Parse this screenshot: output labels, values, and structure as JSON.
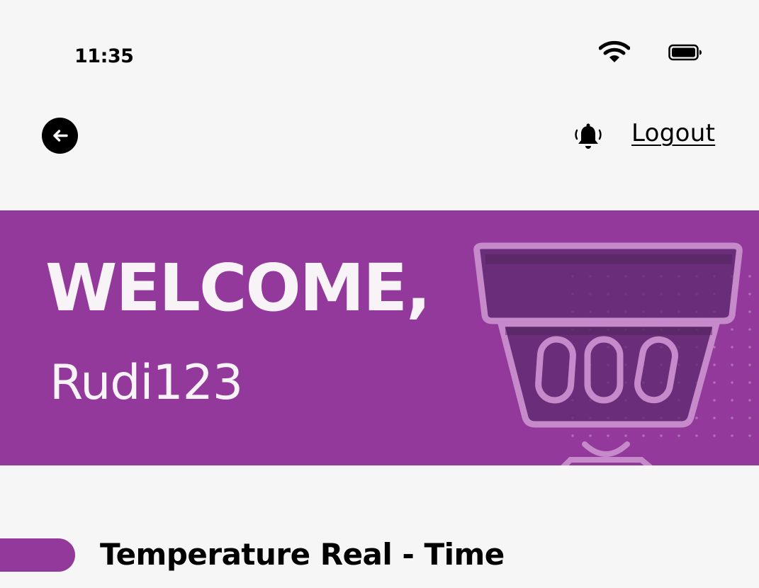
{
  "status_bar": {
    "time": "11:35",
    "wifi_icon": "wifi-icon",
    "battery_icon": "battery-icon"
  },
  "header": {
    "back_icon": "arrow-left-icon",
    "notification_icon": "bell-icon",
    "logout_label": "Logout"
  },
  "banner": {
    "greeting": "WELCOME,",
    "username": "Rudi123",
    "background_color": "#93399b",
    "illustration_icon": "pot-counter-icon"
  },
  "section": {
    "title": "Temperature Real - Time",
    "accent_color": "#93399b"
  }
}
